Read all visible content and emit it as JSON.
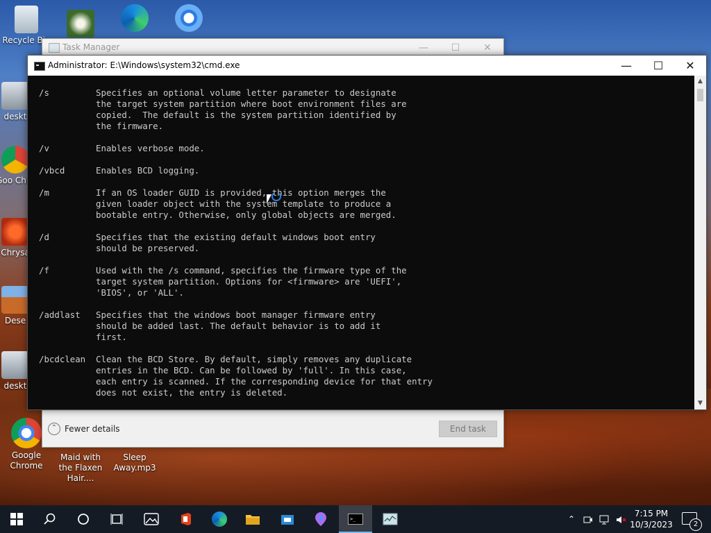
{
  "desktop": {
    "icons": [
      {
        "id": "recycle",
        "label": "Recycle Bin"
      },
      {
        "id": "desk1",
        "label": "deskt"
      },
      {
        "id": "chrome-partial",
        "label": "Goo Chro"
      },
      {
        "id": "chrysa",
        "label": "Chrysa"
      },
      {
        "id": "dese",
        "label": "Dese"
      },
      {
        "id": "desk2",
        "label": "deskt"
      },
      {
        "id": "google-chrome",
        "label": "Google Chrome"
      },
      {
        "id": "maid",
        "label": "Maid with the Flaxen Hair...."
      },
      {
        "id": "sleep",
        "label": "Sleep Away.mp3"
      }
    ]
  },
  "task_manager": {
    "title": "Task Manager",
    "fewer_details": "Fewer details",
    "end_task": "End task"
  },
  "cmd": {
    "title": "Administrator: E:\\Windows\\system32\\cmd.exe",
    "lines": [
      "/s         Specifies an optional volume letter parameter to designate",
      "           the target system partition where boot environment files are",
      "           copied.  The default is the system partition identified by",
      "           the firmware.",
      "",
      "/v         Enables verbose mode.",
      "",
      "/vbcd      Enables BCD logging.",
      "",
      "/m         If an OS loader GUID is provided, this option merges the",
      "           given loader object with the system template to produce a",
      "           bootable entry. Otherwise, only global objects are merged.",
      "",
      "/d         Specifies that the existing default windows boot entry",
      "           should be preserved.",
      "",
      "/f         Used with the /s command, specifies the firmware type of the",
      "           target system partition. Options for <firmware> are 'UEFI',",
      "           'BIOS', or 'ALL'.",
      "",
      "/addlast   Specifies that the windows boot manager firmware entry",
      "           should be added last. The default behavior is to add it",
      "           first.",
      "",
      "/bcdclean  Clean the BCD Store. By default, simply removes any duplicate",
      "           entries in the BCD. Can be followed by 'full'. In this case,",
      "           each entry is scanned. If the corresponding device for that entry",
      "           does not exist, the entry is deleted."
    ]
  },
  "taskbar": {
    "clock_time": "7:15 PM",
    "clock_date": "10/3/2023",
    "notification_count": "2"
  }
}
